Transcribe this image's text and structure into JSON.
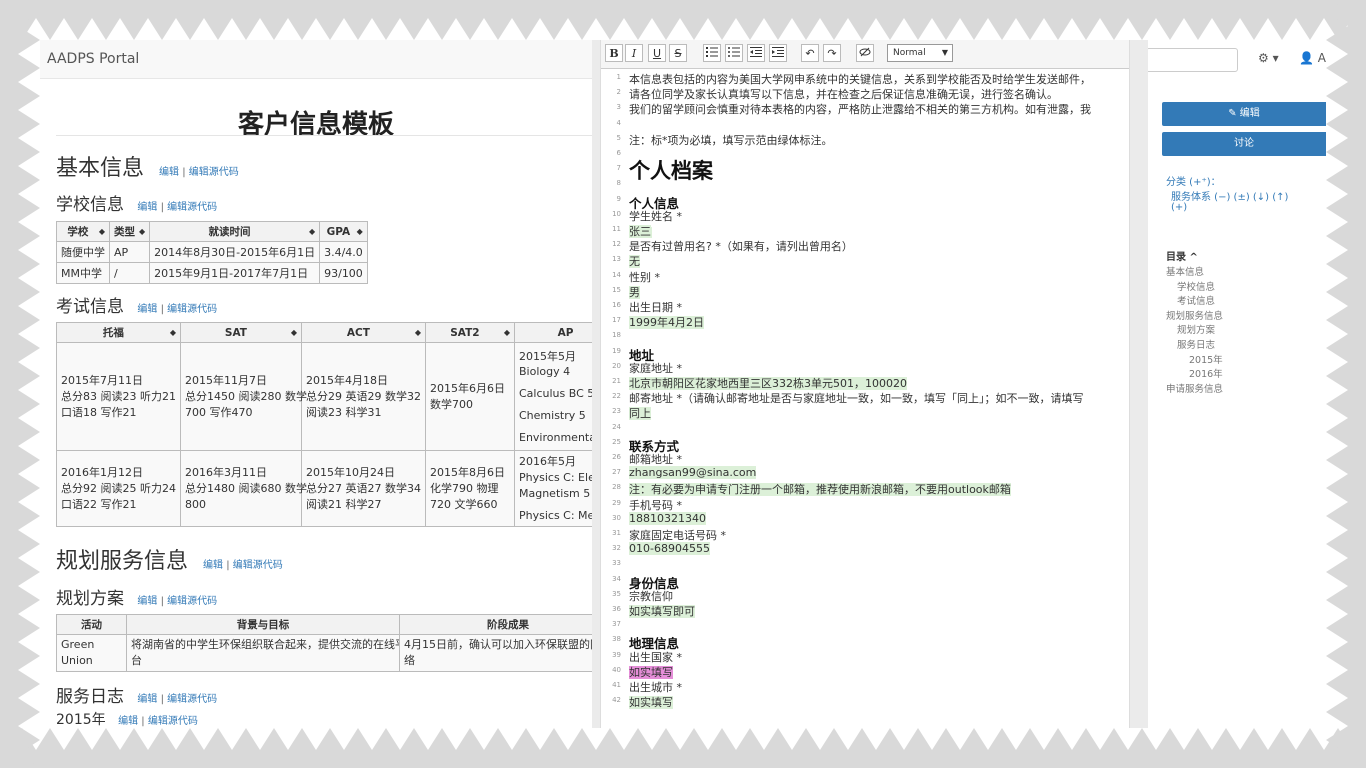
{
  "portal": {
    "brand": "AADPS Portal",
    "page_title": "客户信息模板",
    "edit_label": "编辑",
    "edit_source_label": "编辑源代码",
    "link_sep": "|",
    "sections": {
      "basic_info": "基本信息",
      "school_info": "学校信息",
      "exam_info": "考试信息",
      "plan_services": "规划服务信息",
      "plan": "规划方案",
      "service_log": "服务日志",
      "year_2015": "2015年"
    },
    "school_table": {
      "headers": [
        "学校",
        "类型",
        "就读时间",
        "GPA"
      ],
      "rows": [
        [
          "随便中学",
          "AP",
          "2014年8月30日-2015年6月1日",
          "3.4/4.0"
        ],
        [
          "MM中学",
          "/",
          "2015年9月1日-2017年7月1日",
          "93/100"
        ]
      ]
    },
    "exam_table": {
      "headers": [
        "托福",
        "SAT",
        "ACT",
        "SAT2",
        "AP"
      ],
      "rows": [
        [
          [
            "2015年7月11日",
            "总分83 阅读23 听力21",
            "口语18 写作21"
          ],
          [
            "2015年11月7日",
            "总分1450 阅读280 数学",
            "700 写作470"
          ],
          [
            "2015年4月18日",
            "总分29 英语29 数学32",
            "阅读23 科学31"
          ],
          [
            "2015年6月6日",
            "数学700"
          ],
          [
            "2015年5月",
            "Biology 4",
            "",
            "Calculus BC 5",
            "",
            "Chemistry 5",
            "",
            "Environmenta"
          ]
        ],
        [
          [
            "2016年1月12日",
            "总分92 阅读25 听力24",
            "口语22 写作21"
          ],
          [
            "2016年3月11日",
            "总分1480 阅读680 数学",
            "800"
          ],
          [
            "2015年10月24日",
            "总分27 英语27 数学34",
            "阅读21 科学27"
          ],
          [
            "2015年8月6日",
            "化学790 物理",
            "720 文学660"
          ],
          [
            "2016年5月",
            "Physics C: Elec",
            "Magnetism 5",
            "",
            "Physics C: Mec"
          ]
        ]
      ]
    },
    "plan_table": {
      "headers": [
        "活动",
        "背景与目标",
        "阶段成果"
      ],
      "rows": [
        [
          [
            "Green",
            "Union"
          ],
          [
            "将湖南省的中学生环保组织联合起来，提供交流的在线平",
            "台"
          ],
          [
            "4月15日前，确认可以加入环保联盟的网",
            "络"
          ]
        ]
      ]
    }
  },
  "editor": {
    "toolbar": {
      "bold": "B",
      "italic": "I",
      "underline": "U",
      "strike": "S",
      "undo": "↶",
      "redo": "↷",
      "format_select": "Normal",
      "format_caret": "▼"
    },
    "lines": [
      {
        "n": "1",
        "text": "本信息表包括的内容为美国大学网申系统中的关键信息，关系到学校能否及时给学生发送邮件，",
        "style": ""
      },
      {
        "n": "2",
        "text": "请各位同学及家长认真填写以下信息，并在检查之后保证信息准确无误，进行签名确认。",
        "style": ""
      },
      {
        "n": "3",
        "text": "我们的留学顾问会慎重对待本表格的内容，严格防止泄露给不相关的第三方机构。如有泄露，我",
        "style": ""
      },
      {
        "n": "4",
        "text": "",
        "style": ""
      },
      {
        "n": "5",
        "text": "注：标*项为必填，填写示范由绿体标注。",
        "style": ""
      },
      {
        "n": "6",
        "text": "",
        "style": ""
      },
      {
        "n": "7",
        "text": "个人档案",
        "style": "head1"
      },
      {
        "n": "8",
        "text": "",
        "style": ""
      },
      {
        "n": "9",
        "text": "个人信息",
        "style": "head3"
      },
      {
        "n": "10",
        "text": "学生姓名 *",
        "style": ""
      },
      {
        "n": "11",
        "text": "张三",
        "style": "hl"
      },
      {
        "n": "12",
        "text": "是否有过曾用名? *（如果有，请列出曾用名）",
        "style": ""
      },
      {
        "n": "13",
        "text": "无",
        "style": "hl"
      },
      {
        "n": "14",
        "text": "性别 *",
        "style": ""
      },
      {
        "n": "15",
        "text": "男",
        "style": "hl"
      },
      {
        "n": "16",
        "text": "出生日期 *",
        "style": ""
      },
      {
        "n": "17",
        "text": "1999年4月2日",
        "style": "hl"
      },
      {
        "n": "18",
        "text": "",
        "style": ""
      },
      {
        "n": "19",
        "text": "地址",
        "style": "head3"
      },
      {
        "n": "20",
        "text": "家庭地址 *",
        "style": ""
      },
      {
        "n": "21",
        "text": "北京市朝阳区花家地西里三区332栋3单元501，100020",
        "style": "hl"
      },
      {
        "n": "22",
        "text": "邮寄地址 *（请确认邮寄地址是否与家庭地址一致，如一致，填写「同上」；如不一致，请填写",
        "style": ""
      },
      {
        "n": "23",
        "text": "同上",
        "style": "hl"
      },
      {
        "n": "24",
        "text": "",
        "style": ""
      },
      {
        "n": "25",
        "text": "联系方式",
        "style": "head3"
      },
      {
        "n": "26",
        "text": "邮箱地址 *",
        "style": ""
      },
      {
        "n": "27",
        "text": "zhangsan99@sina.com",
        "style": "hl"
      },
      {
        "n": "28",
        "text": "注：有必要为申请专门注册一个邮箱，推荐使用新浪邮箱，不要用outlook邮箱",
        "style": "hl"
      },
      {
        "n": "29",
        "text": "手机号码 *",
        "style": ""
      },
      {
        "n": "30",
        "text": "18810321340",
        "style": "hl"
      },
      {
        "n": "31",
        "text": "家庭固定电话号码 *",
        "style": ""
      },
      {
        "n": "32",
        "text": "010-68904555",
        "style": "hl"
      },
      {
        "n": "33",
        "text": "",
        "style": ""
      },
      {
        "n": "34",
        "text": "身份信息",
        "style": "head3"
      },
      {
        "n": "35",
        "text": "宗教信仰",
        "style": ""
      },
      {
        "n": "36",
        "text": "如实填写即可",
        "style": "hl"
      },
      {
        "n": "37",
        "text": "",
        "style": ""
      },
      {
        "n": "38",
        "text": "地理信息",
        "style": "head3"
      },
      {
        "n": "39",
        "text": "出生国家 *",
        "style": ""
      },
      {
        "n": "40",
        "text": "如实填写",
        "style": "pink"
      },
      {
        "n": "41",
        "text": "出生城市 *",
        "style": ""
      },
      {
        "n": "42",
        "text": "如实填写",
        "style": "hl"
      }
    ]
  },
  "sidebar": {
    "gear": "⚙ ▾",
    "user": "👤 Ac",
    "edit_button": "✎ 编辑",
    "discuss_button": "讨论",
    "category_label": "分类 (+⁺)：",
    "category_item": "服务体系 (−) (±) (↓) (↑)",
    "category_add": "(+)",
    "toc_title": "目录 ^",
    "toc": [
      {
        "label": "基本信息",
        "level": 1
      },
      {
        "label": "学校信息",
        "level": 2
      },
      {
        "label": "考试信息",
        "level": 2
      },
      {
        "label": "规划服务信息",
        "level": 1
      },
      {
        "label": "规划方案",
        "level": 2
      },
      {
        "label": "服务日志",
        "level": 2
      },
      {
        "label": "2015年",
        "level": 3
      },
      {
        "label": "2016年",
        "level": 3
      },
      {
        "label": "申请服务信息",
        "level": 1
      }
    ]
  },
  "colors": {
    "frame": "#d9d9d9",
    "accent": "#337ab7",
    "highlight": "#dcf0d8",
    "pink_highlight": "#e58ed8"
  }
}
